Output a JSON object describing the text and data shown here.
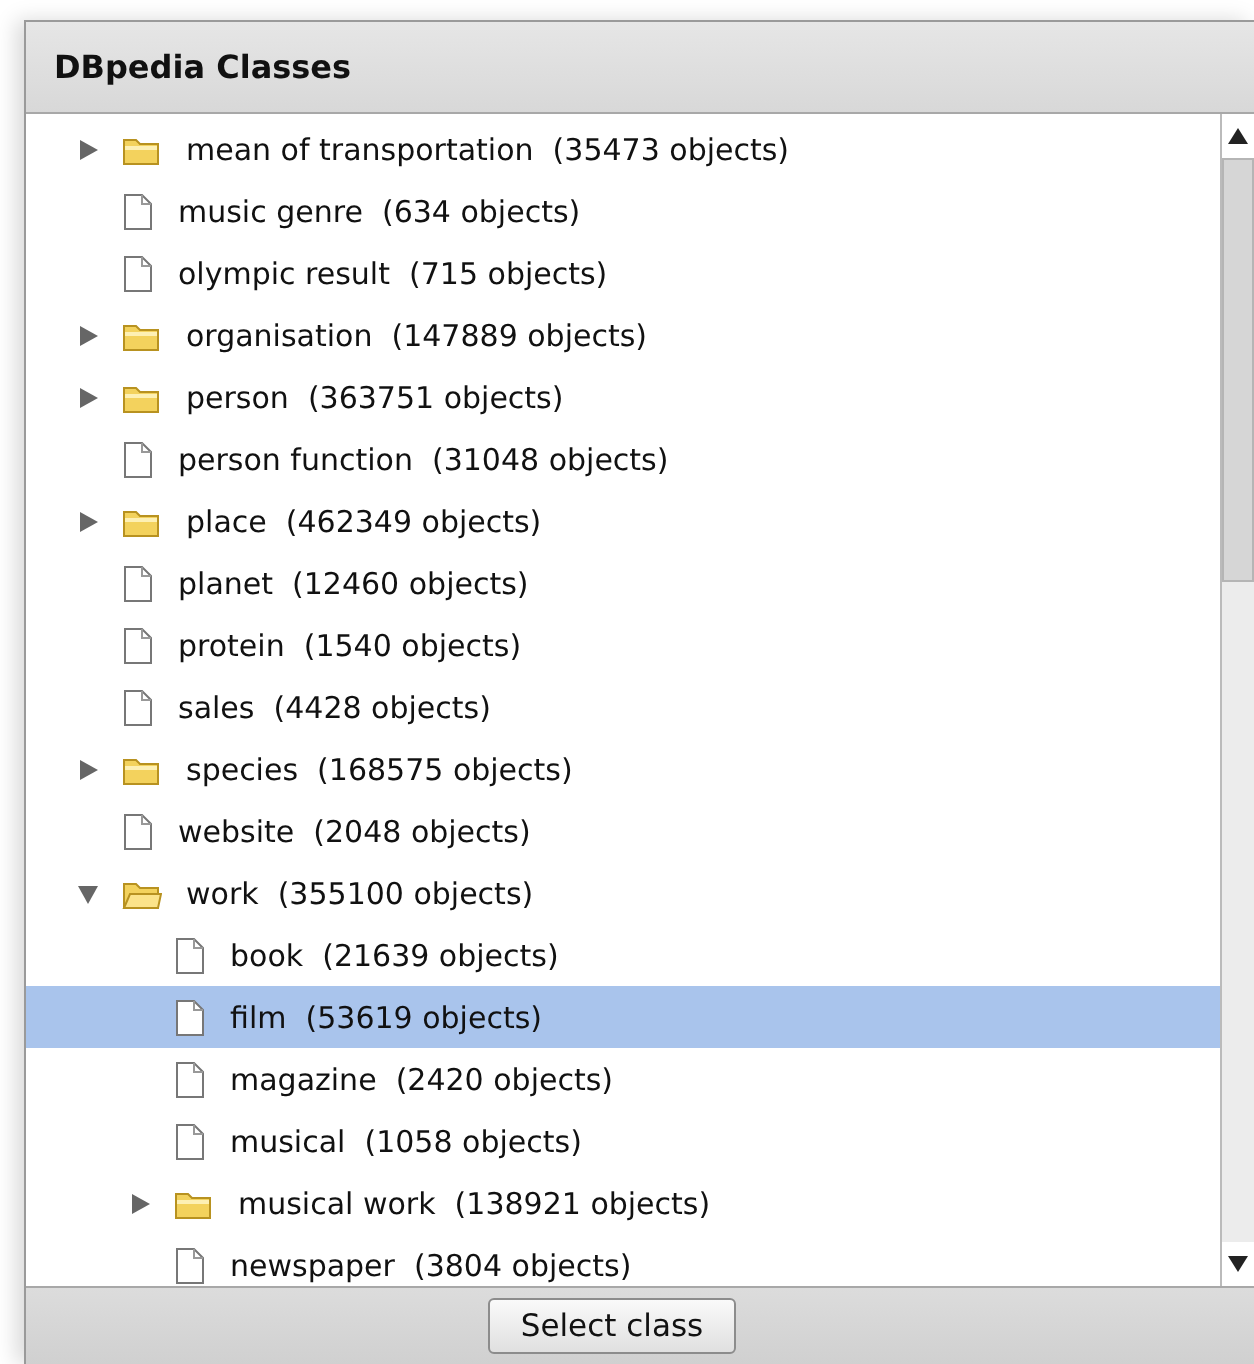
{
  "dialog": {
    "title": "DBpedia Classes"
  },
  "tree": [
    {
      "label": "mean of transportation  (35473 objects)",
      "kind": "folder",
      "expanded": false,
      "selected": false
    },
    {
      "label": "music genre  (634 objects)",
      "kind": "file",
      "selected": false
    },
    {
      "label": "olympic result  (715 objects)",
      "kind": "file",
      "selected": false
    },
    {
      "label": "organisation  (147889 objects)",
      "kind": "folder",
      "expanded": false,
      "selected": false
    },
    {
      "label": "person  (363751 objects)",
      "kind": "folder",
      "expanded": false,
      "selected": false
    },
    {
      "label": "person function  (31048 objects)",
      "kind": "file",
      "selected": false
    },
    {
      "label": "place  (462349 objects)",
      "kind": "folder",
      "expanded": false,
      "selected": false
    },
    {
      "label": "planet  (12460 objects)",
      "kind": "file",
      "selected": false
    },
    {
      "label": "protein  (1540 objects)",
      "kind": "file",
      "selected": false
    },
    {
      "label": "sales  (4428 objects)",
      "kind": "file",
      "selected": false
    },
    {
      "label": "species  (168575 objects)",
      "kind": "folder",
      "expanded": false,
      "selected": false
    },
    {
      "label": "website  (2048 objects)",
      "kind": "file",
      "selected": false
    },
    {
      "label": "work  (355100 objects)",
      "kind": "folder",
      "expanded": true,
      "selected": false,
      "children": [
        {
          "label": "book  (21639 objects)",
          "kind": "file",
          "selected": false
        },
        {
          "label": "film  (53619 objects)",
          "kind": "file",
          "selected": true
        },
        {
          "label": "magazine  (2420 objects)",
          "kind": "file",
          "selected": false
        },
        {
          "label": "musical  (1058 objects)",
          "kind": "file",
          "selected": false
        },
        {
          "label": "musical work  (138921 objects)",
          "kind": "folder",
          "expanded": false,
          "selected": false
        },
        {
          "label": "newspaper  (3804 objects)",
          "kind": "file",
          "selected": false
        }
      ]
    }
  ],
  "buttons": [
    {
      "label": "Select class"
    }
  ]
}
